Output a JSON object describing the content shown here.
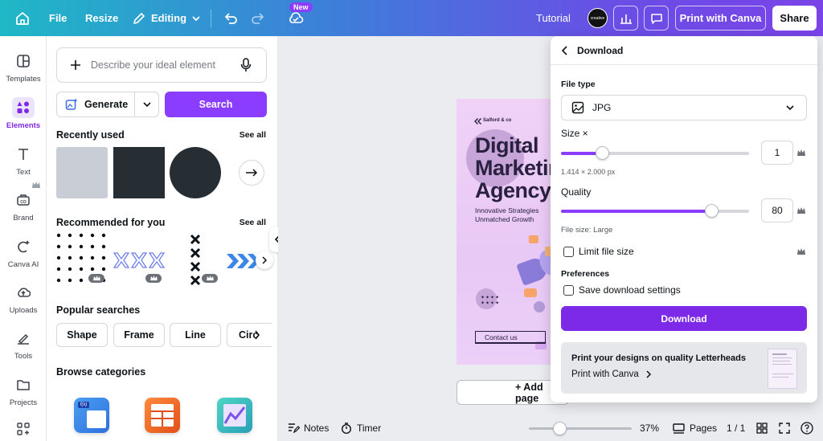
{
  "topbar": {
    "file": "File",
    "resize": "Resize",
    "editing": "Editing",
    "new_badge": "New",
    "tutorial": "Tutorial",
    "avatar_text": "creative",
    "print_btn": "Print with Canva",
    "share_btn": "Share"
  },
  "rail": {
    "items": [
      {
        "label": "Templates",
        "icon": "templates-icon"
      },
      {
        "label": "Elements",
        "icon": "elements-icon"
      },
      {
        "label": "Text",
        "icon": "text-icon"
      },
      {
        "label": "Brand",
        "icon": "brand-icon"
      },
      {
        "label": "Canva AI",
        "icon": "canva-ai-icon"
      },
      {
        "label": "Uploads",
        "icon": "uploads-icon"
      },
      {
        "label": "Tools",
        "icon": "tools-icon"
      },
      {
        "label": "Projects",
        "icon": "projects-icon"
      }
    ]
  },
  "panel": {
    "search_placeholder": "Describe your ideal element",
    "generate": "Generate",
    "search": "Search",
    "recently_used": "Recently used",
    "see_all": "See all",
    "recommended": "Recommended for you",
    "popular": "Popular searches",
    "chips": [
      "Shape",
      "Frame",
      "Line",
      "Circ"
    ],
    "browse": "Browse categories"
  },
  "design": {
    "brand": "Salford & co",
    "headline": [
      "Digital",
      "Marketing",
      "Agency"
    ],
    "sub": [
      "Innovative Strategies",
      "Unmatched Growth"
    ],
    "cta": "Contact us"
  },
  "canvas": {
    "add_page": "+ Add page"
  },
  "bottombar": {
    "notes": "Notes",
    "timer": "Timer",
    "zoom": "37%",
    "pages": "Pages",
    "page_count": "1 / 1",
    "zoom_fraction": 0.3
  },
  "download": {
    "title": "Download",
    "file_type_label": "File type",
    "file_type_value": "JPG",
    "size_label": "Size ×",
    "size_value": "1",
    "size_fraction": 0.22,
    "dimensions": "1.414 × 2.000 px",
    "quality_label": "Quality",
    "quality_value": "80",
    "quality_fraction": 0.8,
    "file_size": "File size: Large",
    "limit_file_size": "Limit file size",
    "preferences": "Preferences",
    "save_settings": "Save download settings",
    "download_btn": "Download",
    "promo_title": "Print your designs on quality Letterheads",
    "promo_link": "Print with Canva"
  },
  "colors": {
    "accent": "#8b3dff",
    "button": "#7d2ae8"
  }
}
